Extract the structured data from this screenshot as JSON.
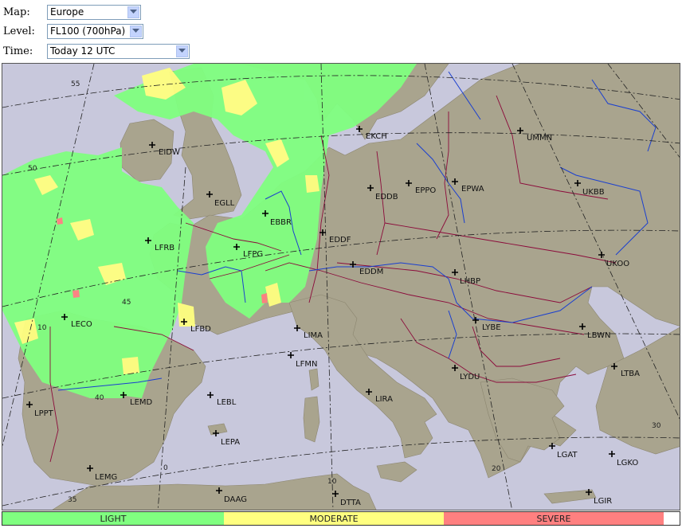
{
  "controls": {
    "map": {
      "label": "Map:",
      "value": "Europe"
    },
    "level": {
      "label": "Level:",
      "value": "FL100 (700hPa)"
    },
    "time": {
      "label": "Time:",
      "value": "Today 12 UTC"
    }
  },
  "stations": [
    {
      "code": "EIDW"
    },
    {
      "code": "EGLL"
    },
    {
      "code": "EBBR"
    },
    {
      "code": "EKCH"
    },
    {
      "code": "EDDB"
    },
    {
      "code": "EPPO"
    },
    {
      "code": "EPWA"
    },
    {
      "code": "UMMN"
    },
    {
      "code": "UKBB"
    },
    {
      "code": "LFRB"
    },
    {
      "code": "LFPG"
    },
    {
      "code": "EDDF"
    },
    {
      "code": "EDDM"
    },
    {
      "code": "LHBP"
    },
    {
      "code": "UKOO"
    },
    {
      "code": "LECO"
    },
    {
      "code": "LFBD"
    },
    {
      "code": "LIMA"
    },
    {
      "code": "LYBE"
    },
    {
      "code": "LBWN"
    },
    {
      "code": "LFMN"
    },
    {
      "code": "LYDU"
    },
    {
      "code": "LTBA"
    },
    {
      "code": "LPPT"
    },
    {
      "code": "LEMD"
    },
    {
      "code": "LEBL"
    },
    {
      "code": "LIRA"
    },
    {
      "code": "LEPA"
    },
    {
      "code": "LGAT"
    },
    {
      "code": "LGKO"
    },
    {
      "code": "LEMG"
    },
    {
      "code": "DAAG"
    },
    {
      "code": "DTTA"
    },
    {
      "code": "LGIR"
    }
  ],
  "grid_labels": [
    {
      "text": "55"
    },
    {
      "text": "50"
    },
    {
      "text": "45"
    },
    {
      "text": "10"
    },
    {
      "text": "40"
    },
    {
      "text": "0"
    },
    {
      "text": "10"
    },
    {
      "text": "20"
    },
    {
      "text": "30"
    },
    {
      "text": "35"
    }
  ],
  "legend": [
    {
      "label": "LIGHT",
      "color": "#80ff80"
    },
    {
      "label": "MODERATE",
      "color": "#ffff80"
    },
    {
      "label": "SEVERE",
      "color": "#ff8080"
    }
  ],
  "colors": {
    "sea": "#c8c8dc",
    "land": "#a9a48e",
    "border": "#8b0a3a",
    "river": "#1a3fd0"
  }
}
